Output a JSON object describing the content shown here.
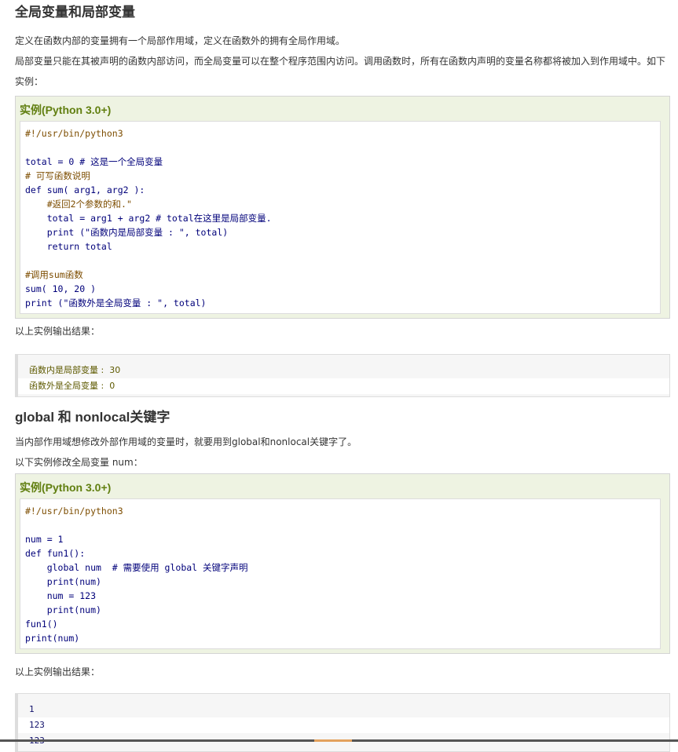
{
  "section1": {
    "heading": "全局变量和局部变量",
    "para1": "定义在函数内部的变量拥有一个局部作用域，定义在函数外的拥有全局作用域。",
    "para2": "局部变量只能在其被声明的函数内部访问，而全局变量可以在整个程序范围内访问。调用函数时，所有在函数内声明的变量名称都将被加入到作用域中。如下实例：",
    "example_title": "实例(Python 3.0+)",
    "code": [
      "#!/usr/bin/python3",
      "",
      "total = 0 # 这是一个全局变量",
      "# 可写函数说明",
      "def sum( arg1, arg2 ):",
      "    #返回2个参数的和.\"",
      "    total = arg1 + arg2 # total在这里是局部变量.",
      "    print (\"函数内是局部变量 : \", total)",
      "    return total",
      "",
      "#调用sum函数",
      "sum( 10, 20 )",
      "print (\"函数外是全局变量 : \", total)"
    ],
    "output_intro": "以上实例输出结果：",
    "output": [
      "函数内是局部变量 :  30",
      "函数外是全局变量 :  0"
    ]
  },
  "section2": {
    "heading": "global 和 nonlocal关键字",
    "para1": "当内部作用域想修改外部作用域的变量时，就要用到global和nonlocal关键字了。",
    "para2": "以下实例修改全局变量 num：",
    "example_title": "实例(Python 3.0+)",
    "code": [
      "#!/usr/bin/python3",
      "",
      "num = 1",
      "def fun1():",
      "    global num  # 需要使用 global 关键字声明",
      "    print(num)",
      "    num = 123",
      "    print(num)",
      "fun1()",
      "print(num)"
    ],
    "output_intro": "以上实例输出结果：",
    "output": [
      "1",
      "123",
      "123"
    ]
  }
}
